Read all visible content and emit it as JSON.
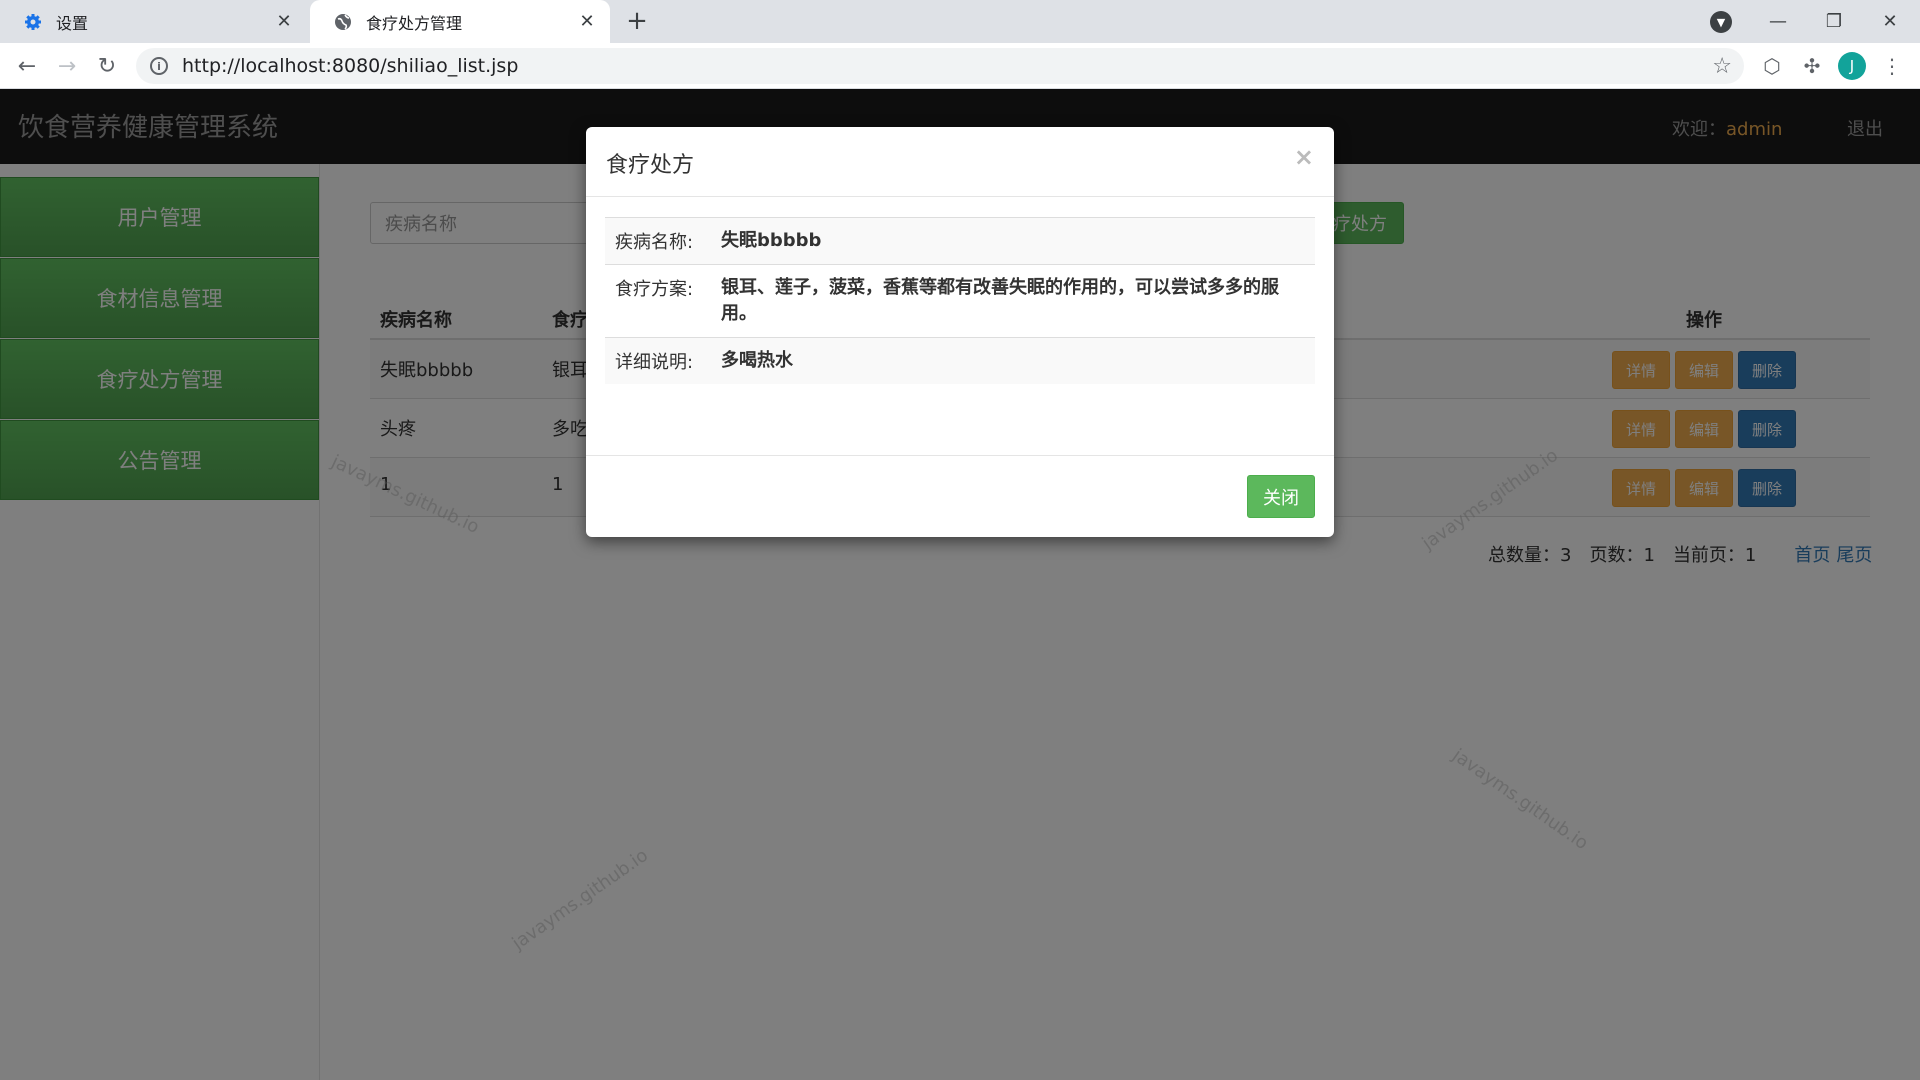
{
  "browser": {
    "tabs": [
      {
        "title": "设置",
        "icon": "gear-icon"
      },
      {
        "title": "食疗处方管理",
        "icon": "globe-icon"
      }
    ],
    "url": "http://localhost:8080/shiliao_list.jsp",
    "profile_initial": "J"
  },
  "app": {
    "title": "饮食营养健康管理系统",
    "welcome_label": "欢迎：",
    "username": "admin",
    "logout": "退出"
  },
  "sidebar": {
    "items": [
      {
        "label": "用户管理"
      },
      {
        "label": "食材信息管理"
      },
      {
        "label": "食疗处方管理"
      },
      {
        "label": "公告管理"
      }
    ]
  },
  "search": {
    "placeholder": "疾病名称",
    "add_label": "疗处方"
  },
  "table": {
    "headers": [
      "疾病名称",
      "食疗",
      "操作"
    ],
    "rows": [
      {
        "disease": "失眠bbbbb",
        "plan": "银耳"
      },
      {
        "disease": "头疼",
        "plan": "多吃"
      },
      {
        "disease": "1",
        "plan": "1"
      }
    ],
    "actions": {
      "detail": "详情",
      "edit": "编辑",
      "delete": "删除"
    }
  },
  "pager": {
    "total": "总数量：3",
    "pages": "页数：1",
    "current": "当前页：1",
    "first": "首页",
    "last": "尾页"
  },
  "watermark": "javayms.github.io",
  "modal": {
    "title": "食疗处方",
    "close_symbol": "×",
    "fields": [
      {
        "label": "疾病名称:",
        "value": "失眠bbbbb"
      },
      {
        "label": "食疗方案:",
        "value": "银耳、莲子，菠菜，香蕉等都有改善失眠的作用的，可以尝试多多的服用。"
      },
      {
        "label": "详细说明:",
        "value": "多喝热水"
      }
    ],
    "close_button": "关闭"
  }
}
